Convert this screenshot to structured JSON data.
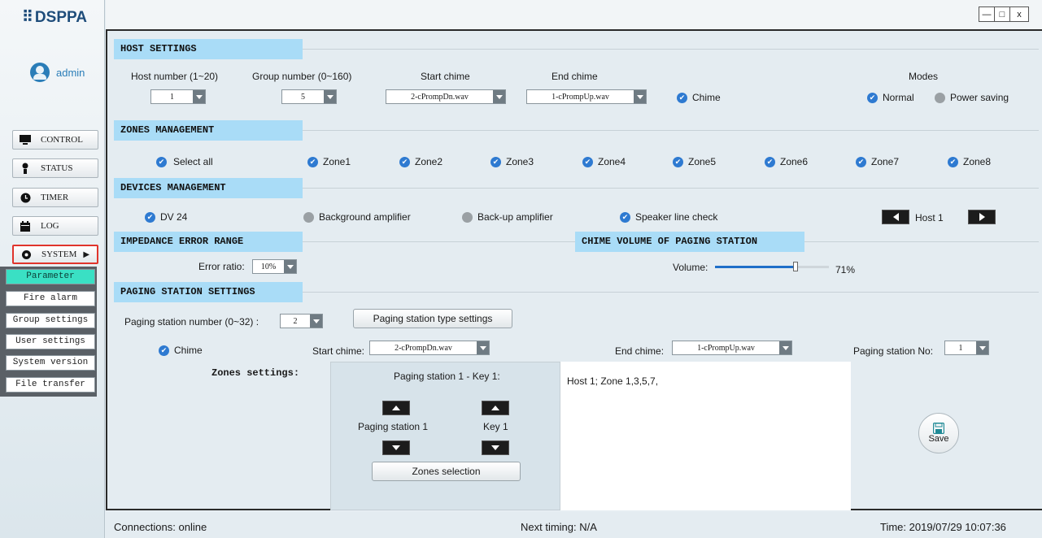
{
  "sidebar": {
    "logo": "DSPPA",
    "user": "admin",
    "nav": [
      {
        "label": "CONTROL",
        "icon": "monitor-icon"
      },
      {
        "label": "STATUS",
        "icon": "person-icon"
      },
      {
        "label": "TIMER",
        "icon": "clock-icon"
      },
      {
        "label": "LOG",
        "icon": "calendar-icon"
      },
      {
        "label": "SYSTEM",
        "icon": "gear-icon"
      }
    ],
    "submenu": [
      "Parameter",
      "Fire alarm",
      "Group settings",
      "User settings",
      "System version",
      "File transfer"
    ],
    "active_submenu": "Parameter"
  },
  "window": {
    "minimize": "—",
    "maximize": "□",
    "close": "x"
  },
  "host": {
    "title": "HOST SETTINGS",
    "host_number_label": "Host number  (1~20)",
    "host_number_value": "1",
    "group_number_label": "Group number  (0~160)",
    "group_number_value": "5",
    "start_chime_label": "Start chime",
    "start_chime_value": "2-cPrompDn.wav",
    "end_chime_label": "End chime",
    "end_chime_value": "1-cPrompUp.wav",
    "chime_label": "Chime",
    "modes_label": "Modes",
    "normal_label": "Normal",
    "power_saving_label": "Power saving"
  },
  "zones": {
    "title": "ZONES MANAGEMENT",
    "select_all": "Select all",
    "items": [
      "Zone1",
      "Zone2",
      "Zone3",
      "Zone4",
      "Zone5",
      "Zone6",
      "Zone7",
      "Zone8"
    ]
  },
  "devices": {
    "title": "DEVICES MANAGEMENT",
    "dv24": "DV 24",
    "background_amp": "Background amplifier",
    "backup_amp": "Back-up amplifier",
    "speaker_check": "Speaker line check",
    "host_label": "Host 1"
  },
  "impedance": {
    "title": "IMPEDANCE ERROR RANGE",
    "error_ratio_label": "Error ratio:",
    "error_ratio_value": "10%"
  },
  "chime_volume": {
    "title": "CHIME VOLUME OF PAGING STATION",
    "volume_label": "Volume:",
    "volume_percent": 71,
    "volume_text": "71%"
  },
  "paging": {
    "title": "PAGING STATION SETTINGS",
    "number_label": "Paging station number  (0~32) :",
    "number_value": "2",
    "type_settings_button": "Paging station type settings",
    "chime_label": "Chime",
    "start_chime_label": "Start chime:",
    "start_chime_value": "2-cPrompDn.wav",
    "end_chime_label": "End chime:",
    "end_chime_value": "1-cPrompUp.wav",
    "station_no_label": "Paging station No:",
    "station_no_value": "1",
    "zones_settings_label": "Zones settings:",
    "panel_title": "Paging station 1 - Key 1:",
    "station_label": "Paging station 1",
    "key_label": "Key 1",
    "zones_selection_button": "Zones selection",
    "result_text": "Host 1; Zone 1,3,5,7,",
    "save_label": "Save"
  },
  "status": {
    "connections": "Connections: online",
    "next_timing": "Next timing: N/A",
    "time": "Time:  2019/07/29  10:07:36"
  }
}
